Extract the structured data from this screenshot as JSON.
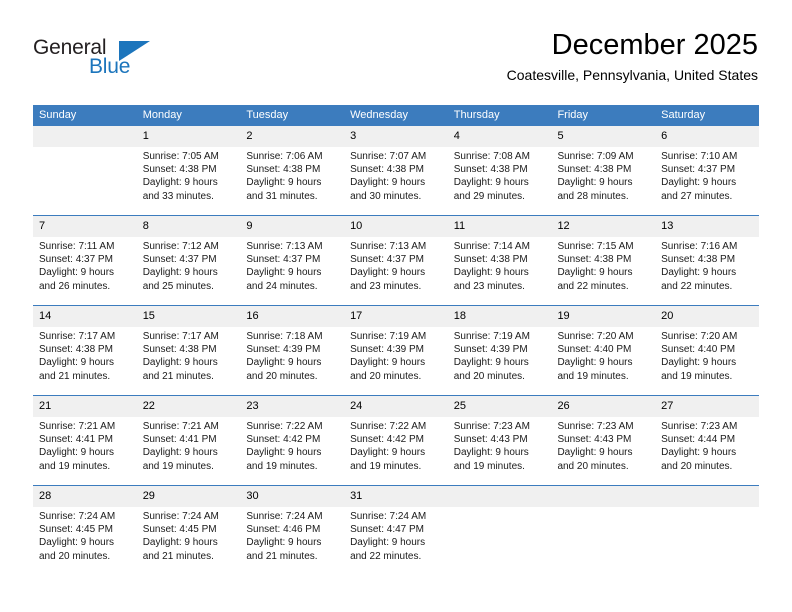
{
  "logo": {
    "text_top": "General",
    "text_bottom": "Blue",
    "triangle_icon": "triangle-icon",
    "color_dark": "#231f20",
    "color_blue": "#1c75bc"
  },
  "header": {
    "title": "December 2025",
    "subtitle": "Coatesville, Pennsylvania, United States"
  },
  "theme": {
    "header_row_bg": "#3c7cbe",
    "daynum_bg": "#f0f0f0",
    "cell_bg": "#ffffff",
    "text": "#000000"
  },
  "weekday_headers": [
    "Sunday",
    "Monday",
    "Tuesday",
    "Wednesday",
    "Thursday",
    "Friday",
    "Saturday"
  ],
  "weeks": [
    [
      {
        "day": "",
        "blank": true,
        "sunrise": "",
        "sunset": "",
        "daylight_line1": "",
        "daylight_line2": ""
      },
      {
        "day": "1",
        "blank": false,
        "sunrise": "Sunrise: 7:05 AM",
        "sunset": "Sunset: 4:38 PM",
        "daylight_line1": "Daylight: 9 hours",
        "daylight_line2": "and 33 minutes."
      },
      {
        "day": "2",
        "blank": false,
        "sunrise": "Sunrise: 7:06 AM",
        "sunset": "Sunset: 4:38 PM",
        "daylight_line1": "Daylight: 9 hours",
        "daylight_line2": "and 31 minutes."
      },
      {
        "day": "3",
        "blank": false,
        "sunrise": "Sunrise: 7:07 AM",
        "sunset": "Sunset: 4:38 PM",
        "daylight_line1": "Daylight: 9 hours",
        "daylight_line2": "and 30 minutes."
      },
      {
        "day": "4",
        "blank": false,
        "sunrise": "Sunrise: 7:08 AM",
        "sunset": "Sunset: 4:38 PM",
        "daylight_line1": "Daylight: 9 hours",
        "daylight_line2": "and 29 minutes."
      },
      {
        "day": "5",
        "blank": false,
        "sunrise": "Sunrise: 7:09 AM",
        "sunset": "Sunset: 4:38 PM",
        "daylight_line1": "Daylight: 9 hours",
        "daylight_line2": "and 28 minutes."
      },
      {
        "day": "6",
        "blank": false,
        "sunrise": "Sunrise: 7:10 AM",
        "sunset": "Sunset: 4:37 PM",
        "daylight_line1": "Daylight: 9 hours",
        "daylight_line2": "and 27 minutes."
      }
    ],
    [
      {
        "day": "7",
        "blank": false,
        "sunrise": "Sunrise: 7:11 AM",
        "sunset": "Sunset: 4:37 PM",
        "daylight_line1": "Daylight: 9 hours",
        "daylight_line2": "and 26 minutes."
      },
      {
        "day": "8",
        "blank": false,
        "sunrise": "Sunrise: 7:12 AM",
        "sunset": "Sunset: 4:37 PM",
        "daylight_line1": "Daylight: 9 hours",
        "daylight_line2": "and 25 minutes."
      },
      {
        "day": "9",
        "blank": false,
        "sunrise": "Sunrise: 7:13 AM",
        "sunset": "Sunset: 4:37 PM",
        "daylight_line1": "Daylight: 9 hours",
        "daylight_line2": "and 24 minutes."
      },
      {
        "day": "10",
        "blank": false,
        "sunrise": "Sunrise: 7:13 AM",
        "sunset": "Sunset: 4:37 PM",
        "daylight_line1": "Daylight: 9 hours",
        "daylight_line2": "and 23 minutes."
      },
      {
        "day": "11",
        "blank": false,
        "sunrise": "Sunrise: 7:14 AM",
        "sunset": "Sunset: 4:38 PM",
        "daylight_line1": "Daylight: 9 hours",
        "daylight_line2": "and 23 minutes."
      },
      {
        "day": "12",
        "blank": false,
        "sunrise": "Sunrise: 7:15 AM",
        "sunset": "Sunset: 4:38 PM",
        "daylight_line1": "Daylight: 9 hours",
        "daylight_line2": "and 22 minutes."
      },
      {
        "day": "13",
        "blank": false,
        "sunrise": "Sunrise: 7:16 AM",
        "sunset": "Sunset: 4:38 PM",
        "daylight_line1": "Daylight: 9 hours",
        "daylight_line2": "and 22 minutes."
      }
    ],
    [
      {
        "day": "14",
        "blank": false,
        "sunrise": "Sunrise: 7:17 AM",
        "sunset": "Sunset: 4:38 PM",
        "daylight_line1": "Daylight: 9 hours",
        "daylight_line2": "and 21 minutes."
      },
      {
        "day": "15",
        "blank": false,
        "sunrise": "Sunrise: 7:17 AM",
        "sunset": "Sunset: 4:38 PM",
        "daylight_line1": "Daylight: 9 hours",
        "daylight_line2": "and 21 minutes."
      },
      {
        "day": "16",
        "blank": false,
        "sunrise": "Sunrise: 7:18 AM",
        "sunset": "Sunset: 4:39 PM",
        "daylight_line1": "Daylight: 9 hours",
        "daylight_line2": "and 20 minutes."
      },
      {
        "day": "17",
        "blank": false,
        "sunrise": "Sunrise: 7:19 AM",
        "sunset": "Sunset: 4:39 PM",
        "daylight_line1": "Daylight: 9 hours",
        "daylight_line2": "and 20 minutes."
      },
      {
        "day": "18",
        "blank": false,
        "sunrise": "Sunrise: 7:19 AM",
        "sunset": "Sunset: 4:39 PM",
        "daylight_line1": "Daylight: 9 hours",
        "daylight_line2": "and 20 minutes."
      },
      {
        "day": "19",
        "blank": false,
        "sunrise": "Sunrise: 7:20 AM",
        "sunset": "Sunset: 4:40 PM",
        "daylight_line1": "Daylight: 9 hours",
        "daylight_line2": "and 19 minutes."
      },
      {
        "day": "20",
        "blank": false,
        "sunrise": "Sunrise: 7:20 AM",
        "sunset": "Sunset: 4:40 PM",
        "daylight_line1": "Daylight: 9 hours",
        "daylight_line2": "and 19 minutes."
      }
    ],
    [
      {
        "day": "21",
        "blank": false,
        "sunrise": "Sunrise: 7:21 AM",
        "sunset": "Sunset: 4:41 PM",
        "daylight_line1": "Daylight: 9 hours",
        "daylight_line2": "and 19 minutes."
      },
      {
        "day": "22",
        "blank": false,
        "sunrise": "Sunrise: 7:21 AM",
        "sunset": "Sunset: 4:41 PM",
        "daylight_line1": "Daylight: 9 hours",
        "daylight_line2": "and 19 minutes."
      },
      {
        "day": "23",
        "blank": false,
        "sunrise": "Sunrise: 7:22 AM",
        "sunset": "Sunset: 4:42 PM",
        "daylight_line1": "Daylight: 9 hours",
        "daylight_line2": "and 19 minutes."
      },
      {
        "day": "24",
        "blank": false,
        "sunrise": "Sunrise: 7:22 AM",
        "sunset": "Sunset: 4:42 PM",
        "daylight_line1": "Daylight: 9 hours",
        "daylight_line2": "and 19 minutes."
      },
      {
        "day": "25",
        "blank": false,
        "sunrise": "Sunrise: 7:23 AM",
        "sunset": "Sunset: 4:43 PM",
        "daylight_line1": "Daylight: 9 hours",
        "daylight_line2": "and 19 minutes."
      },
      {
        "day": "26",
        "blank": false,
        "sunrise": "Sunrise: 7:23 AM",
        "sunset": "Sunset: 4:43 PM",
        "daylight_line1": "Daylight: 9 hours",
        "daylight_line2": "and 20 minutes."
      },
      {
        "day": "27",
        "blank": false,
        "sunrise": "Sunrise: 7:23 AM",
        "sunset": "Sunset: 4:44 PM",
        "daylight_line1": "Daylight: 9 hours",
        "daylight_line2": "and 20 minutes."
      }
    ],
    [
      {
        "day": "28",
        "blank": false,
        "sunrise": "Sunrise: 7:24 AM",
        "sunset": "Sunset: 4:45 PM",
        "daylight_line1": "Daylight: 9 hours",
        "daylight_line2": "and 20 minutes."
      },
      {
        "day": "29",
        "blank": false,
        "sunrise": "Sunrise: 7:24 AM",
        "sunset": "Sunset: 4:45 PM",
        "daylight_line1": "Daylight: 9 hours",
        "daylight_line2": "and 21 minutes."
      },
      {
        "day": "30",
        "blank": false,
        "sunrise": "Sunrise: 7:24 AM",
        "sunset": "Sunset: 4:46 PM",
        "daylight_line1": "Daylight: 9 hours",
        "daylight_line2": "and 21 minutes."
      },
      {
        "day": "31",
        "blank": false,
        "sunrise": "Sunrise: 7:24 AM",
        "sunset": "Sunset: 4:47 PM",
        "daylight_line1": "Daylight: 9 hours",
        "daylight_line2": "and 22 minutes."
      },
      {
        "day": "",
        "blank": true,
        "sunrise": "",
        "sunset": "",
        "daylight_line1": "",
        "daylight_line2": ""
      },
      {
        "day": "",
        "blank": true,
        "sunrise": "",
        "sunset": "",
        "daylight_line1": "",
        "daylight_line2": ""
      },
      {
        "day": "",
        "blank": true,
        "sunrise": "",
        "sunset": "",
        "daylight_line1": "",
        "daylight_line2": ""
      }
    ]
  ]
}
